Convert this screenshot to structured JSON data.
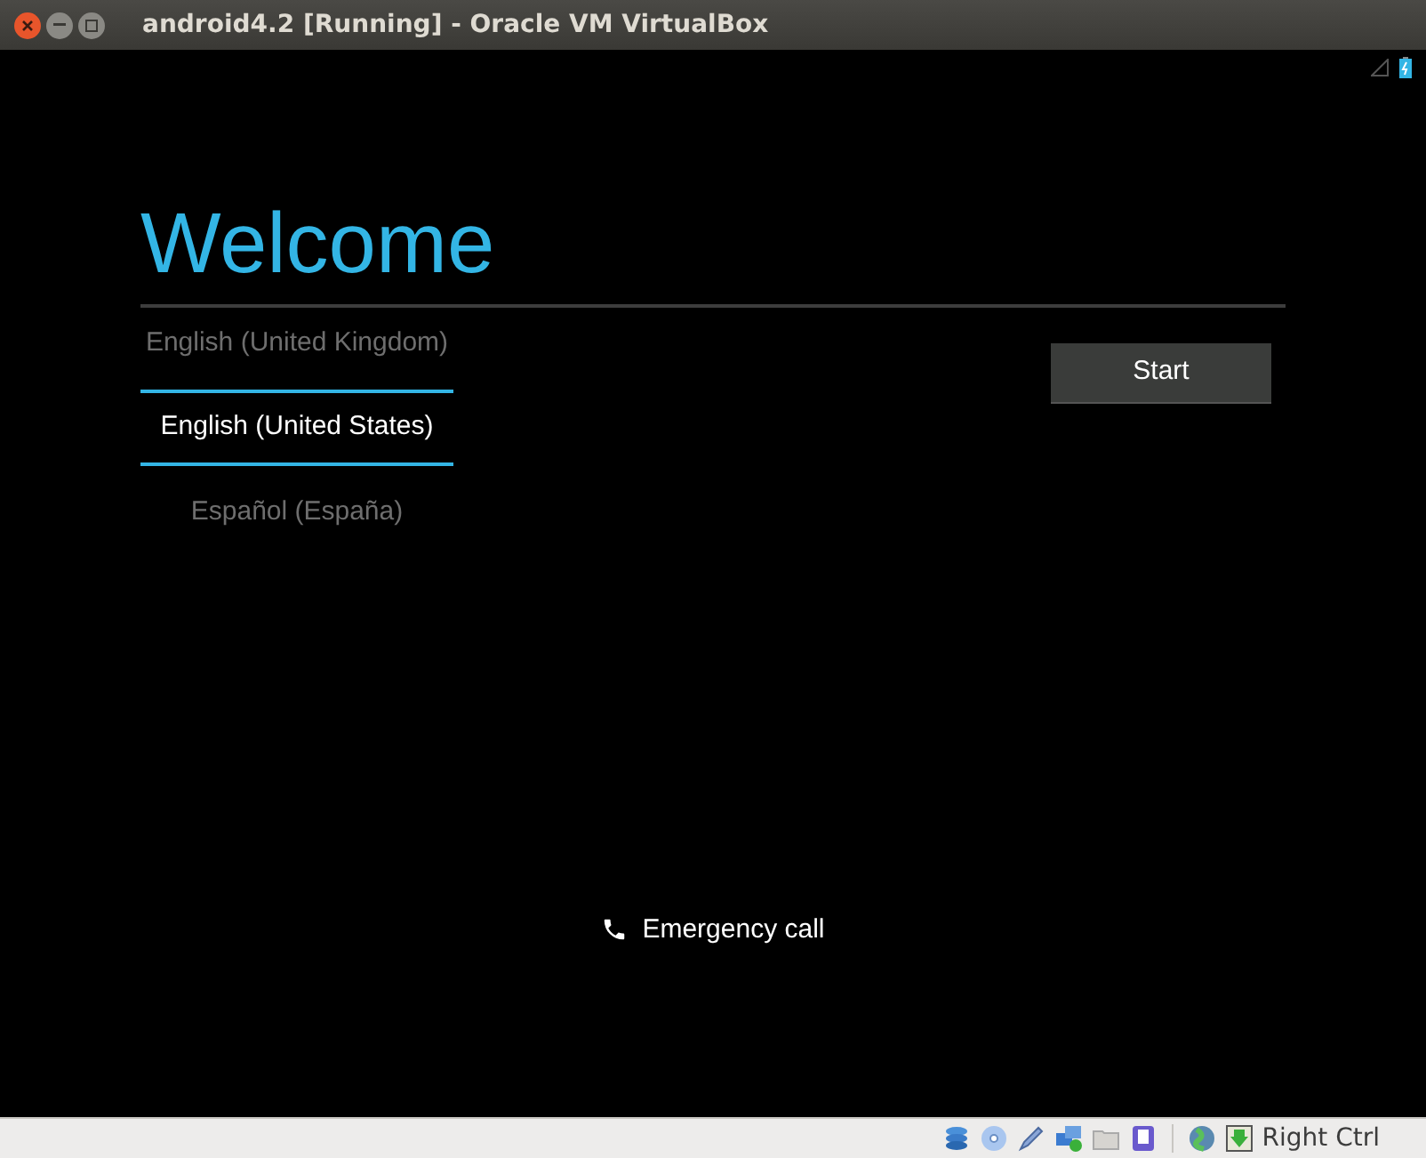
{
  "window": {
    "title": "android4.2 [Running] - Oracle VM VirtualBox"
  },
  "screen": {
    "heading": "Welcome",
    "languages": [
      {
        "label": "English (United Kingdom)",
        "selected": false
      },
      {
        "label": "English (United States)",
        "selected": true
      },
      {
        "label": "Español (España)",
        "selected": false
      }
    ],
    "start_button": "Start",
    "emergency_call": "Emergency call"
  },
  "status_bar": {
    "host_key": "Right Ctrl"
  }
}
